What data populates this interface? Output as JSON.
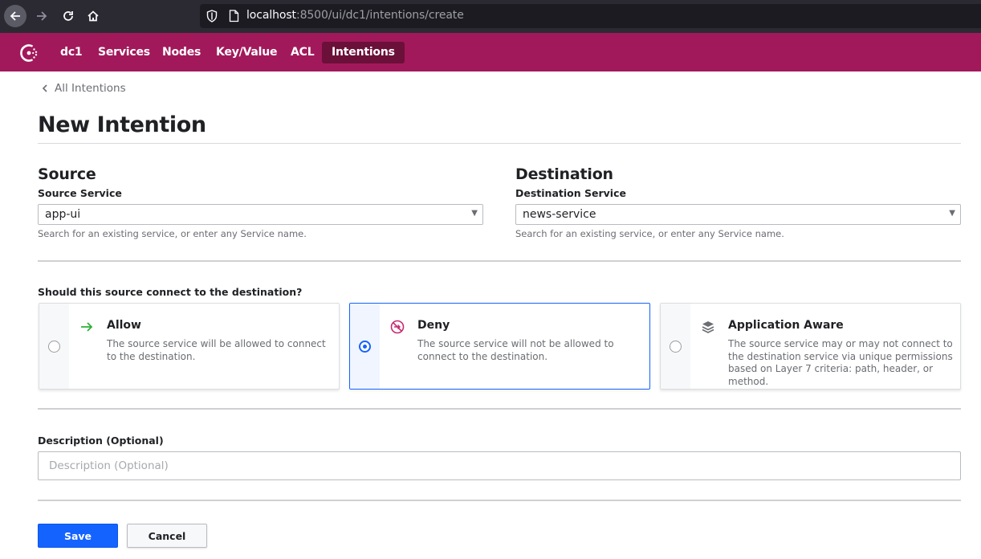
{
  "browser": {
    "url_host": "localhost",
    "url_rest": ":8500/ui/dc1/intentions/create"
  },
  "header": {
    "logo_icon": "consul-logo-icon",
    "nav": [
      {
        "label": "dc1",
        "active": false
      },
      {
        "label": "Services",
        "active": false
      },
      {
        "label": "Nodes",
        "active": false
      },
      {
        "label": "Key/Value",
        "active": false
      },
      {
        "label": "ACL",
        "active": false
      },
      {
        "label": "Intentions",
        "active": true
      }
    ],
    "brand_color": "#a2195b",
    "active_color": "#6b1039"
  },
  "breadcrumb": {
    "label": "All Intentions",
    "icon": "chevron-left-icon"
  },
  "page_title": "New Intention",
  "source": {
    "heading": "Source",
    "label": "Source Service",
    "value": "app-ui",
    "help": "Search for an existing service, or enter any Service name."
  },
  "destination": {
    "heading": "Destination",
    "label": "Destination Service",
    "value": "news-service",
    "help": "Search for an existing service, or enter any Service name."
  },
  "action": {
    "question": "Should this source connect to the destination?",
    "options": [
      {
        "title": "Allow",
        "desc": "The source service will be allowed to connect to the destination.",
        "icon": "arrow-right-icon",
        "selected": false
      },
      {
        "title": "Deny",
        "desc": "The source service will not be allowed to connect to the destination.",
        "icon": "deny-icon",
        "selected": true
      },
      {
        "title": "Application Aware",
        "desc": "The source service may or may not connect to the destination service via unique permissions based on Layer 7 criteria: path, header, or method.",
        "icon": "layers-icon",
        "selected": false
      }
    ]
  },
  "description": {
    "label": "Description (Optional)",
    "placeholder": "Description (Optional)",
    "value": ""
  },
  "buttons": {
    "save": "Save",
    "cancel": "Cancel"
  },
  "accent_color": "#1563ff"
}
